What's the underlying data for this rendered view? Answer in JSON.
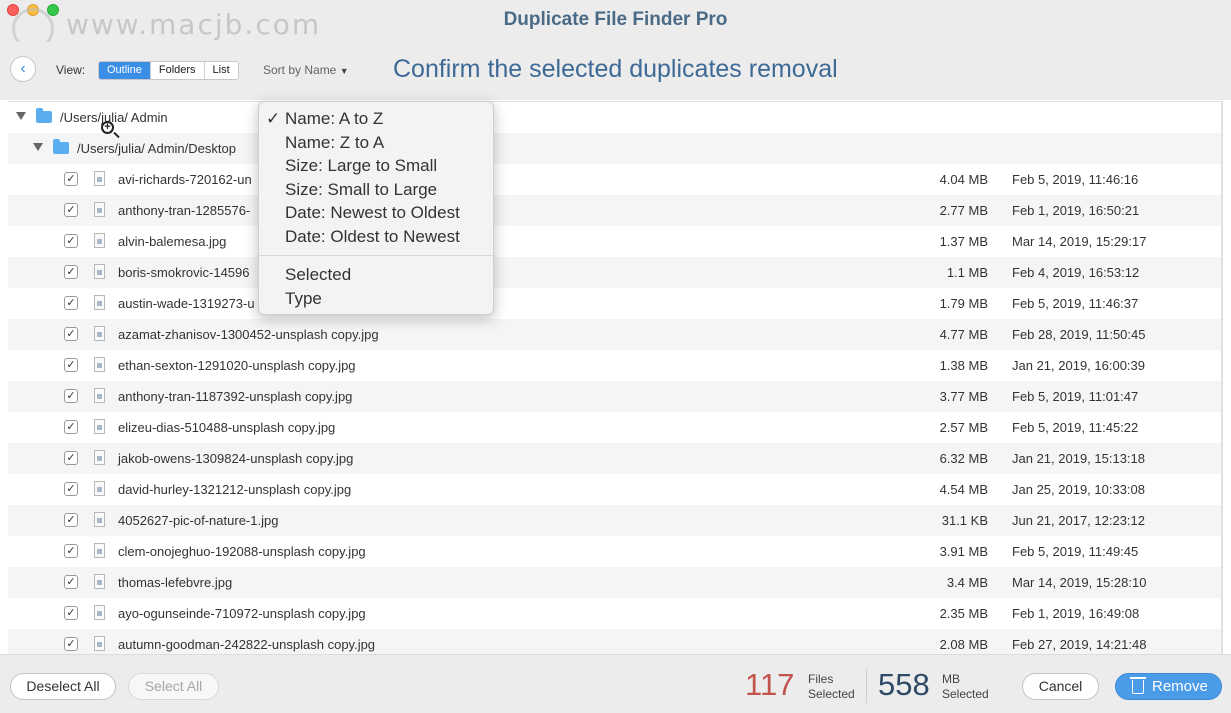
{
  "window": {
    "title": "Duplicate File Finder Pro",
    "watermark": "www.macjb.com"
  },
  "toolbar": {
    "back_icon": "chevron-left-icon",
    "view_label": "View:",
    "view_options": [
      "Outline",
      "Folders",
      "List"
    ],
    "view_selected": "Outline",
    "sort_label": "Sort by Name",
    "heading": "Confirm the selected duplicates removal"
  },
  "tree": {
    "root_path": "/Users/julia/ Admin",
    "sub_path": "/Users/julia/ Admin/Desktop"
  },
  "files": [
    {
      "checked": true,
      "name": "avi-richards-720162-un",
      "size": "4.04 MB",
      "date": "Feb 5, 2019, 11:46:16"
    },
    {
      "checked": true,
      "name": "anthony-tran-1285576-",
      "size": "2.77 MB",
      "date": "Feb 1, 2019, 16:50:21"
    },
    {
      "checked": true,
      "name": "alvin-balemesa.jpg",
      "size": "1.37 MB",
      "date": "Mar 14, 2019, 15:29:17"
    },
    {
      "checked": true,
      "name": "boris-smokrovic-14596",
      "size": "1.1 MB",
      "date": "Feb 4, 2019, 16:53:12"
    },
    {
      "checked": true,
      "name": "austin-wade-1319273-u",
      "size": "1.79 MB",
      "date": "Feb 5, 2019, 11:46:37"
    },
    {
      "checked": true,
      "name": "azamat-zhanisov-1300452-unsplash copy.jpg",
      "size": "4.77 MB",
      "date": "Feb 28, 2019, 11:50:45"
    },
    {
      "checked": true,
      "name": "ethan-sexton-1291020-unsplash copy.jpg",
      "size": "1.38 MB",
      "date": "Jan 21, 2019, 16:00:39"
    },
    {
      "checked": true,
      "name": "anthony-tran-1187392-unsplash copy.jpg",
      "size": "3.77 MB",
      "date": "Feb 5, 2019, 11:01:47"
    },
    {
      "checked": true,
      "name": "elizeu-dias-510488-unsplash copy.jpg",
      "size": "2.57 MB",
      "date": "Feb 5, 2019, 11:45:22"
    },
    {
      "checked": true,
      "name": "jakob-owens-1309824-unsplash copy.jpg",
      "size": "6.32 MB",
      "date": "Jan 21, 2019, 15:13:18"
    },
    {
      "checked": true,
      "name": "david-hurley-1321212-unsplash copy.jpg",
      "size": "4.54 MB",
      "date": "Jan 25, 2019, 10:33:08"
    },
    {
      "checked": true,
      "name": "4052627-pic-of-nature-1.jpg",
      "size": "31.1 KB",
      "date": "Jun 21, 2017, 12:23:12"
    },
    {
      "checked": true,
      "name": "clem-onojeghuo-192088-unsplash copy.jpg",
      "size": "3.91 MB",
      "date": "Feb 5, 2019, 11:49:45"
    },
    {
      "checked": true,
      "name": "thomas-lefebvre.jpg",
      "size": "3.4 MB",
      "date": "Mar 14, 2019, 15:28:10"
    },
    {
      "checked": true,
      "name": "ayo-ogunseinde-710972-unsplash copy.jpg",
      "size": "2.35 MB",
      "date": "Feb 1, 2019, 16:49:08"
    },
    {
      "checked": true,
      "name": "autumn-goodman-242822-unsplash copy.jpg",
      "size": "2.08 MB",
      "date": "Feb 27, 2019, 14:21:48"
    }
  ],
  "sort_menu": {
    "items": [
      "Name: A to Z",
      "Name: Z to A",
      "Size: Large to Small",
      "Size: Small to Large",
      "Date: Newest to Oldest",
      "Date: Oldest to Newest"
    ],
    "checked_item": "Name: A to Z",
    "extra_items": [
      "Selected",
      "Type"
    ],
    "check_mark": "✓"
  },
  "footer": {
    "deselect_all": "Deselect All",
    "select_all": "Select All",
    "files_count": "117",
    "files_label_line1": "Files",
    "files_label_line2": "Selected",
    "mb_count": "558",
    "mb_label_line1": "MB",
    "mb_label_line2": "Selected",
    "cancel": "Cancel",
    "remove": "Remove"
  },
  "colors": {
    "accent": "#3a8ee6",
    "title": "#4a6a86",
    "heading": "#3d6a96",
    "files_count": "#c2544e",
    "mb_count": "#2f4a66",
    "remove_button": "#4a9be8"
  }
}
